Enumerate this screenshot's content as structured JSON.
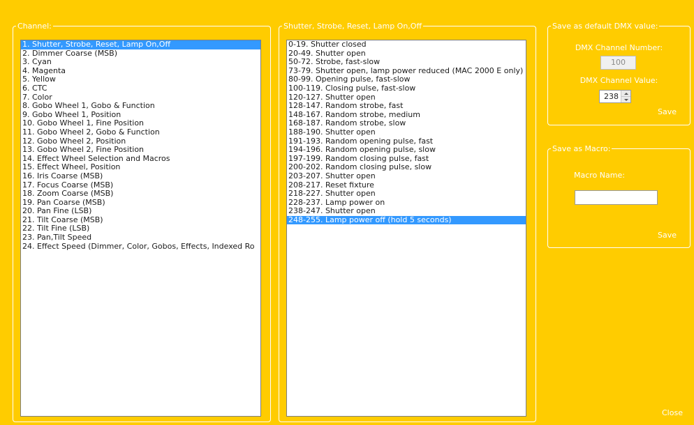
{
  "channel_group": {
    "title": "Channel:",
    "selected_index": 0,
    "items": [
      "1. Shutter, Strobe, Reset, Lamp On,Off",
      "2. Dimmer Coarse (MSB)",
      "3. Cyan",
      "4. Magenta",
      "5. Yellow",
      "6. CTC",
      "7. Color",
      "8. Gobo Wheel 1, Gobo & Function",
      "9. Gobo Wheel 1, Position",
      "10. Gobo Wheel 1, Fine Position",
      "11. Gobo Wheel 2, Gobo & Function",
      "12. Gobo Wheel 2, Position",
      "13. Gobo Wheel 2, Fine Position",
      "14. Effect Wheel Selection and Macros",
      "15. Effect Wheel, Position",
      "16. Iris Coarse (MSB)",
      "17. Focus Coarse (MSB)",
      "18. Zoom Coarse (MSB)",
      "19. Pan Coarse (MSB)",
      "20. Pan Fine (LSB)",
      "21. Tilt Coarse (MSB)",
      "22. Tilt Fine (LSB)",
      "23. Pan,Tilt Speed",
      "24. Effect Speed (Dimmer, Color, Gobos, Effects, Indexed Ro"
    ]
  },
  "values_group": {
    "title": "Shutter, Strobe, Reset, Lamp On,Off",
    "selected_index": 20,
    "items": [
      "0-19. Shutter closed",
      "20-49. Shutter open",
      "50-72. Strobe, fast-slow",
      "73-79. Shutter open, lamp power reduced (MAC 2000 E only)",
      "80-99. Opening pulse, fast-slow",
      "100-119. Closing pulse, fast-slow",
      "120-127. Shutter open",
      "128-147. Random strobe, fast",
      "148-167. Random strobe, medium",
      "168-187. Random strobe, slow",
      "188-190. Shutter open",
      "191-193. Random opening pulse, fast",
      "194-196. Random opening pulse, slow",
      "197-199. Random closing pulse, fast",
      "200-202. Random closing pulse, slow",
      "203-207. Shutter open",
      "208-217. Reset fixture",
      "218-227. Shutter open",
      "228-237. Lamp power on",
      "238-247. Shutter open",
      "248-255. Lamp power off (hold 5 seconds)"
    ]
  },
  "default_group": {
    "title": "Save as default DMX value:",
    "channel_number_label": "DMX Channel Number:",
    "channel_number_value": "100",
    "channel_value_label": "DMX Channel Value:",
    "channel_value": "238",
    "save_label": "Save"
  },
  "macro_group": {
    "title": "Save as Macro:",
    "macro_name_label": "Macro Name:",
    "macro_name_value": "",
    "save_label": "Save"
  },
  "close_label": "Close",
  "colors": {
    "background": "#FFCC00",
    "selection": "#3399FF",
    "label_text": "#FFFFFF"
  }
}
